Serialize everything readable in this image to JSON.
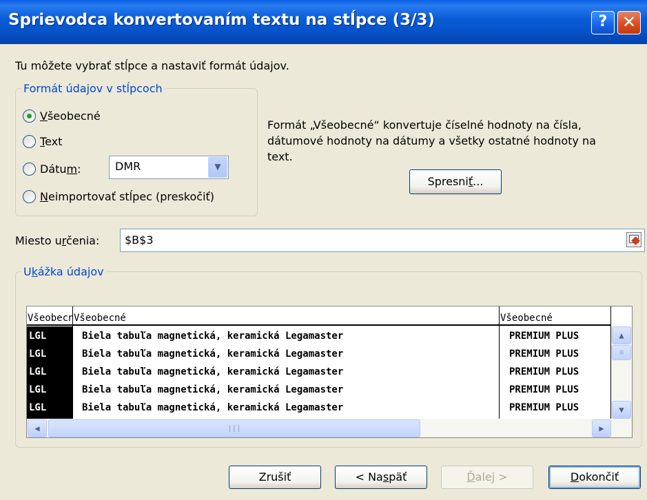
{
  "window": {
    "title": "Sprievodca konvertovaním textu na stĺpce (3/3)",
    "help_glyph": "?",
    "close_glyph": "✕"
  },
  "intro": "Tu môžete vybrať stĺpce a nastaviť formát údajov.",
  "format_group": {
    "title": "Formát údajov v stĺpcoch",
    "options": [
      {
        "pre": "",
        "key": "V",
        "post": "šeobecné",
        "checked": true
      },
      {
        "pre": "",
        "key": "T",
        "post": "ext",
        "checked": false
      },
      {
        "pre": "Dátu",
        "key": "m",
        "post": ":",
        "checked": false
      },
      {
        "pre": "",
        "key": "N",
        "post": "eimportovať stĺpec (preskočiť)",
        "checked": false
      }
    ],
    "date_format": "DMR"
  },
  "description": [
    "Formát „Všeobecné“ konvertuje číselné hodnoty na čísla,",
    "dátumové hodnoty na dátumy a všetky ostatné hodnoty na",
    "text."
  ],
  "advanced_button": {
    "pre": "Spresni",
    "key": "ť",
    "post": "..."
  },
  "destination": {
    "label_pre": "Miesto u",
    "label_key": "r",
    "label_post": "čenia:",
    "value": "$B$3"
  },
  "preview_group": {
    "title_pre": "U",
    "title_key": "k",
    "title_post": "ážka údajov",
    "headers": [
      "Všeobecné",
      "Všeobecné",
      "Všeobecné"
    ],
    "rows": [
      [
        "LGL",
        "Biela tabuľa magnetická, keramická Legamaster",
        "PREMIUM PLUS"
      ],
      [
        "LGL",
        "Biela tabuľa magnetická, keramická Legamaster",
        "PREMIUM PLUS"
      ],
      [
        "LGL",
        "Biela tabuľa magnetická, keramická Legamaster",
        "PREMIUM PLUS"
      ],
      [
        "LGL",
        "Biela tabuľa magnetická, keramická Legamaster",
        "PREMIUM PLUS"
      ],
      [
        "LGL",
        "Biela tabuľa magnetická, keramická Legamaster",
        "PREMIUM PLUS"
      ]
    ]
  },
  "buttons": {
    "cancel": "Zrušiť",
    "back_pre": "< Na",
    "back_key": "s",
    "back_post": "päť",
    "next_pre": "",
    "next_key": "Ď",
    "next_post": "alej >",
    "finish_pre": "",
    "finish_key": "D",
    "finish_post": "okončiť"
  },
  "colors": {
    "title_gradient": "#0551c7",
    "group_title": "#0046d5",
    "radio_dot": "#21a121",
    "background": "#ece9d8"
  }
}
